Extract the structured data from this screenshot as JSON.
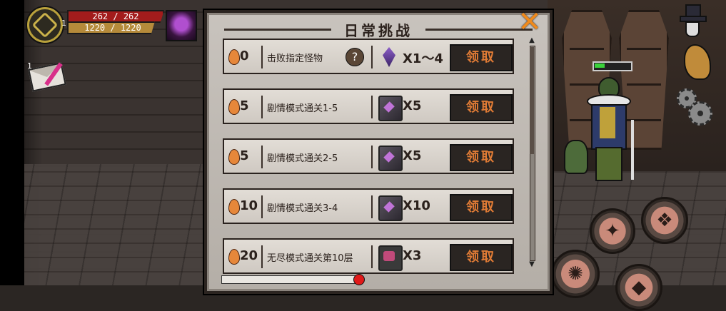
{
  "hud": {
    "level": "1",
    "hp": "262 / 262",
    "mp": "1220 / 1220",
    "mail_count": "1"
  },
  "panel": {
    "title": "日常挑战",
    "close_label": "✕"
  },
  "tasks": [
    {
      "points": "0",
      "name": "击败指定怪物",
      "has_help": true,
      "help_label": "?",
      "reward_icon": "purple-crystal-icon",
      "quantity": "X1～4",
      "claim_label": "领取"
    },
    {
      "points": "5",
      "name": "剧情模式通关1-5",
      "has_help": false,
      "reward_icon": "skill-book-icon",
      "quantity": "X5",
      "claim_label": "领取"
    },
    {
      "points": "5",
      "name": "剧情模式通关2-5",
      "has_help": false,
      "reward_icon": "skill-book-icon",
      "quantity": "X5",
      "claim_label": "领取"
    },
    {
      "points": "10",
      "name": "剧情模式通关3-4",
      "has_help": false,
      "reward_icon": "skill-book-icon",
      "quantity": "X10",
      "claim_label": "领取"
    },
    {
      "points": "20",
      "name": "无尽模式通关第10层",
      "has_help": false,
      "reward_icon": "treasure-chest-icon",
      "quantity": "X3",
      "claim_label": "领取"
    }
  ],
  "colors": {
    "accent_orange": "#e07b35",
    "hp_red": "#a31c1c",
    "mp_gold": "#b58a3a",
    "progress_knob": "#e01919"
  },
  "icons": [
    "guild-emblem-icon",
    "character-portrait-icon",
    "mail-icon",
    "top-hat-character-icon",
    "hand-icon",
    "settings-gear-icon",
    "battery-icon",
    "flame-icon",
    "close-icon"
  ]
}
